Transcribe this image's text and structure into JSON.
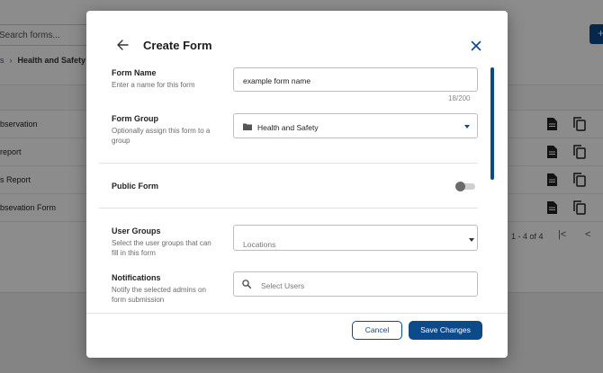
{
  "background": {
    "search_placeholder": "Search forms...",
    "breadcrumb_parent": "s",
    "breadcrumb_current": "Health and Safety",
    "add_button_label": "+",
    "rows": [
      {
        "name": "bservation"
      },
      {
        "name": "report"
      },
      {
        "name": "s Report"
      },
      {
        "name": "bsevation Form"
      }
    ],
    "pager": "1 - 4 of 4"
  },
  "modal": {
    "title": "Create Form",
    "form_name": {
      "label": "Form Name",
      "hint": "Enter a name for this form",
      "value": "example form name",
      "counter": "18/200"
    },
    "form_group": {
      "label": "Form Group",
      "hint": "Optionally assign this form to a group",
      "value": "Health and Safety"
    },
    "public_form": {
      "label": "Public Form",
      "enabled": false
    },
    "user_groups": {
      "label": "User Groups",
      "hint": "Select the user groups that can fill in this form",
      "placeholder": "Locations"
    },
    "notifications": {
      "label": "Notifications",
      "hint": "Notify the selected admins on form submission",
      "placeholder": "Select Users"
    },
    "cancel_label": "Cancel",
    "save_label": "Save Changes"
  },
  "colors": {
    "primary": "#0d4a8a",
    "overlay": "rgba(0,0,0,0.45)"
  }
}
